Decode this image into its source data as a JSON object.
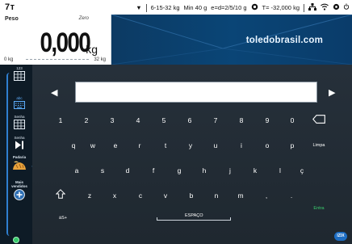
{
  "statusbar": {
    "model": "7т",
    "range": "6-15-32 kg",
    "min": "Min 40 g",
    "division": "e=d=2/5/10 g",
    "tare": "T= -32,000 kg"
  },
  "weight": {
    "label": "Peso",
    "zero": "Zero",
    "value": "0,000",
    "unit": "kg",
    "min_label": "0 kg",
    "max_label": "32 kg"
  },
  "banner": {
    "brand": "toledobrasil.com"
  },
  "sidebar": {
    "btn1": "123",
    "btn2": "abc",
    "btn3": "Senha",
    "btn4": "Senha",
    "btn5": "Padaria",
    "btn6": "Mais vendidos"
  },
  "keyboard": {
    "row1": [
      "1",
      "2",
      "3",
      "4",
      "5",
      "6",
      "7",
      "8",
      "9",
      "0"
    ],
    "row2": [
      "q",
      "w",
      "e",
      "r",
      "t",
      "y",
      "u",
      "i",
      "o",
      "p"
    ],
    "row3": [
      "a",
      "s",
      "d",
      "f",
      "g",
      "h",
      "j",
      "k",
      "l",
      "ç"
    ],
    "row4": [
      "z",
      "x",
      "c",
      "v",
      "b",
      "n",
      "m",
      ",",
      "."
    ],
    "clear": "Limpa",
    "enter": "Entra",
    "symbols": "àS+",
    "space": "ESPAÇO"
  },
  "logo": "IZIX",
  "colors": {
    "accent": "#2f7fd0",
    "enter": "#3bd16f",
    "banner": "#0a4576"
  }
}
